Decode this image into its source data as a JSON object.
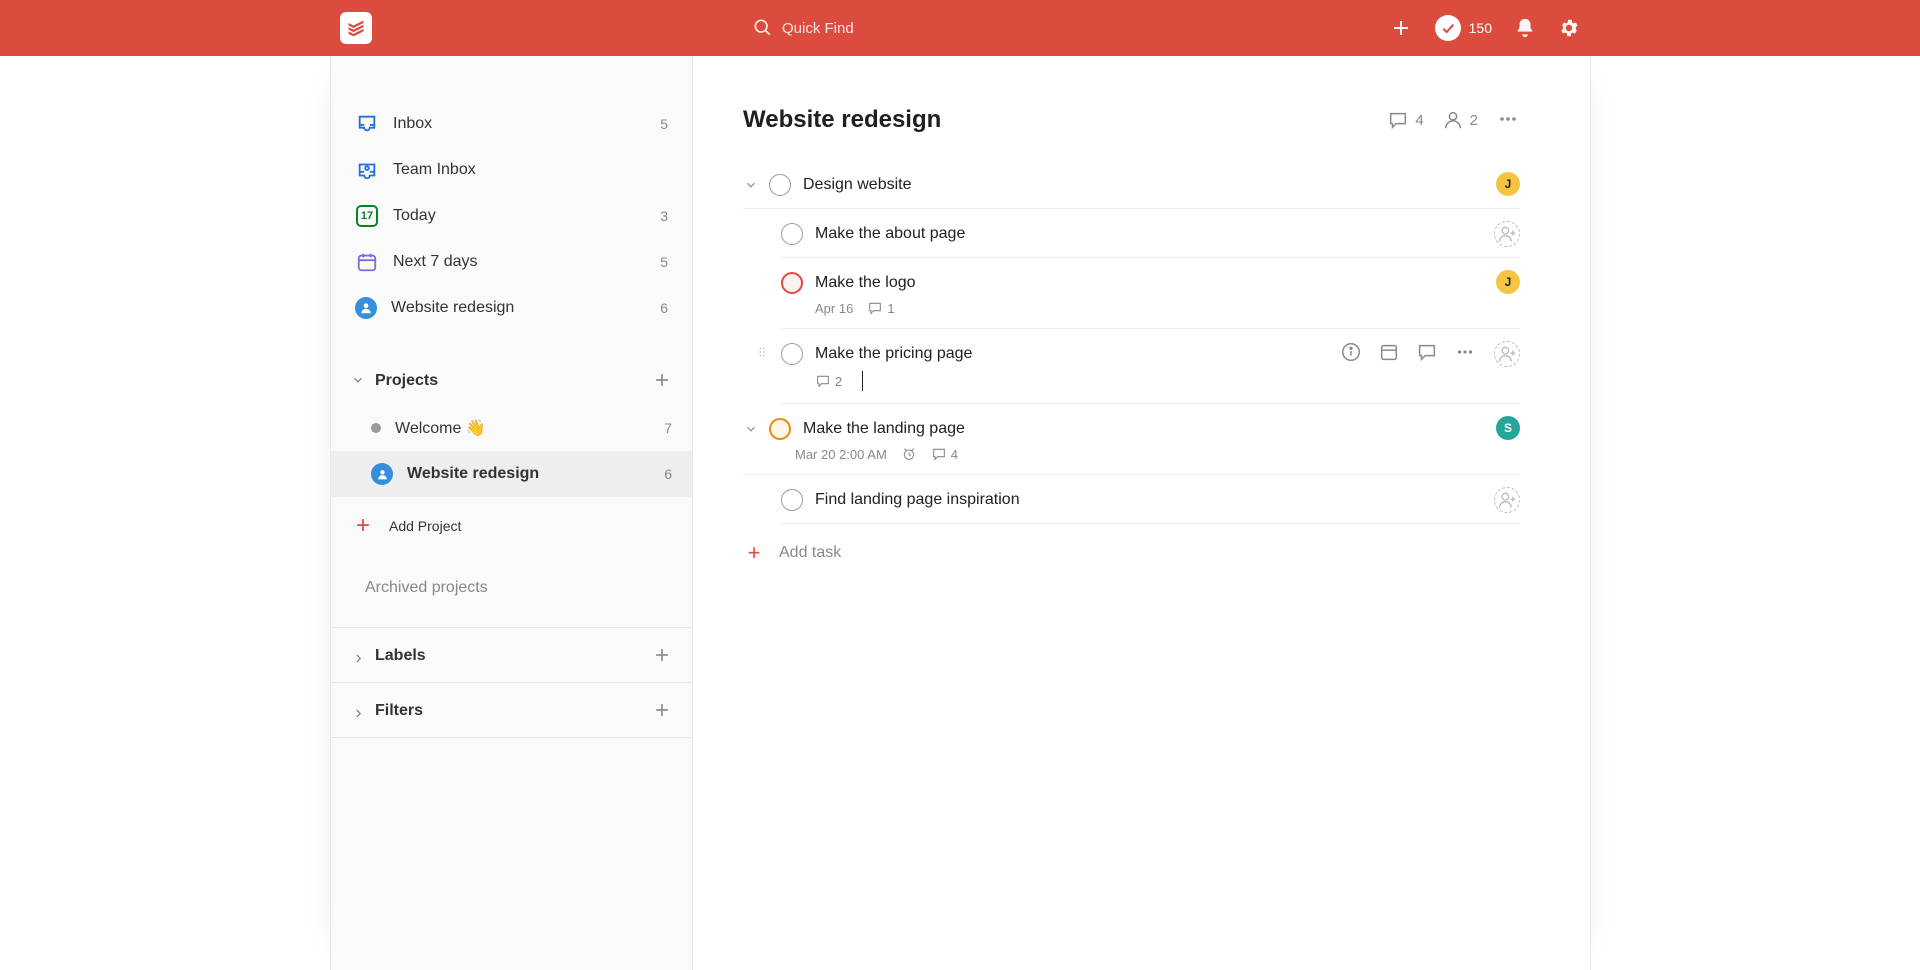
{
  "topbar": {
    "search_placeholder": "Quick Find",
    "karma_points": "150"
  },
  "sidebar": {
    "items": [
      {
        "label": "Inbox",
        "count": "5",
        "icon": "inbox"
      },
      {
        "label": "Team Inbox",
        "count": "",
        "icon": "teaminbox"
      },
      {
        "label": "Today",
        "count": "3",
        "icon": "today",
        "today_date": "17"
      },
      {
        "label": "Next 7 days",
        "count": "5",
        "icon": "next7",
        "color": "purple"
      },
      {
        "label": "Website redesign",
        "count": "6",
        "icon": "user"
      }
    ],
    "projects_label": "Projects",
    "projects": [
      {
        "label": "Welcome 👋",
        "count": "7",
        "bullet_color": "#999",
        "active": false,
        "icon": "dot"
      },
      {
        "label": "Website redesign",
        "count": "6",
        "bullet_color": "#3490dc",
        "active": true,
        "icon": "user"
      }
    ],
    "add_project_label": "Add Project",
    "archived_label": "Archived projects",
    "labels_label": "Labels",
    "filters_label": "Filters"
  },
  "main": {
    "title": "Website redesign",
    "header_comments": "4",
    "header_people": "2",
    "tasks": [
      {
        "id": "t1",
        "title": "Design website",
        "indent": 0,
        "has_children": true,
        "priority": "",
        "assignee": {
          "type": "avatar",
          "initial": "J",
          "color": "yellow"
        }
      },
      {
        "id": "t2",
        "title": "Make the about page",
        "indent": 1,
        "priority": "",
        "assignee": {
          "type": "add"
        }
      },
      {
        "id": "t3",
        "title": "Make the logo",
        "indent": 1,
        "priority": "p1",
        "date": "Apr 16",
        "date_overdue": false,
        "comments": "1",
        "assignee": {
          "type": "avatar",
          "initial": "J",
          "color": "yellow"
        }
      },
      {
        "id": "t4",
        "title": "Make the pricing page",
        "indent": 1,
        "priority": "",
        "comments": "2",
        "hovered": true,
        "assignee": {
          "type": "add"
        }
      },
      {
        "id": "t5",
        "title": "Make the landing page",
        "indent": 0,
        "has_children": true,
        "priority": "p2",
        "date": "Mar 20 2:00 AM",
        "date_overdue": false,
        "has_reminder": true,
        "comments": "4",
        "assignee": {
          "type": "avatar",
          "initial": "S",
          "color": "teal"
        }
      },
      {
        "id": "t6",
        "title": "Find landing page inspiration",
        "indent": 1,
        "priority": "",
        "assignee": {
          "type": "add"
        }
      }
    ],
    "add_task_label": "Add task"
  }
}
